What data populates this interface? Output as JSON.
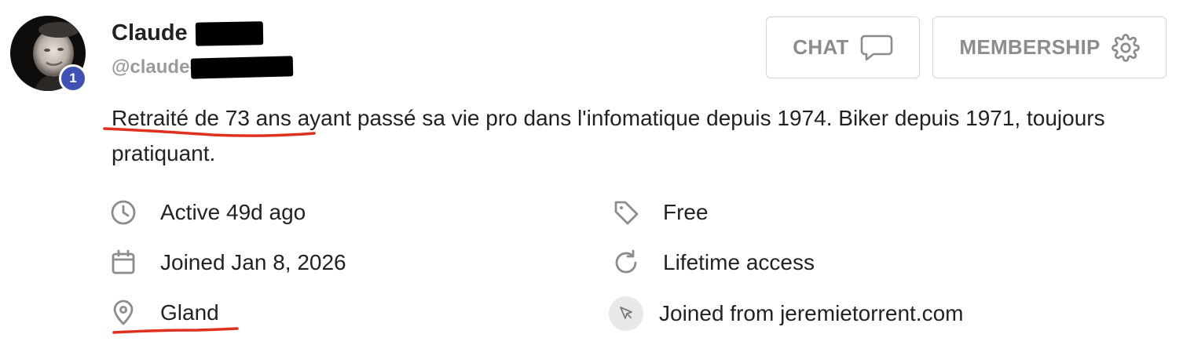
{
  "profile": {
    "first_name": "Claude",
    "handle": "@claude-",
    "level": "1",
    "bio": "Retraité de 73 ans ayant passé sa vie pro dans l'infomatique depuis 1974. Biker depuis 1971, toujours pratiquant."
  },
  "actions": {
    "chat_label": "CHAT",
    "membership_label": "MEMBERSHIP"
  },
  "details": {
    "active": "Active 49d ago",
    "joined": "Joined Jan 8, 2026",
    "location": "Gland",
    "plan": "Free",
    "access": "Lifetime access",
    "source": "Joined from jeremietorrent.com"
  },
  "colors": {
    "badge": "#3f51b5",
    "annotation": "#e0301e",
    "muted": "#8c8c8c"
  },
  "icons": [
    "clock-icon",
    "calendar-icon",
    "location-pin-icon",
    "tag-icon",
    "refresh-icon",
    "cursor-icon",
    "chat-bubble-icon",
    "gear-icon"
  ]
}
